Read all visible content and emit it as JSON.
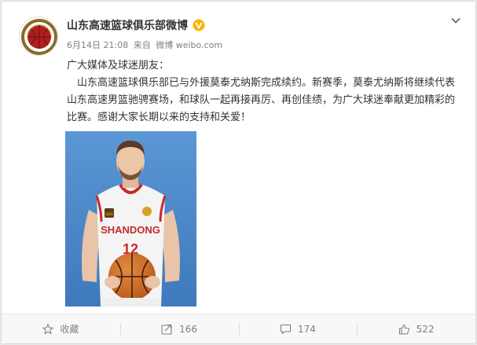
{
  "post": {
    "author": "山东高速篮球俱乐部微博",
    "verified_badge": "V",
    "date": "6月14日 21:08",
    "source_prefix": "来自",
    "source": "微博 weibo.com",
    "greeting": "广大媒体及球迷朋友：",
    "body": "山东高速篮球俱乐部已与外援莫泰尤纳斯完成续约。新赛季，莫泰尤纳斯将继续代表山东高速男篮驰骋赛场，和球队一起再接再厉、再创佳绩，为广大球迷奉献更加精彩的比赛。感谢大家长期以来的支持和关爱！",
    "photo": {
      "jersey_text": "SHANDONG",
      "jersey_number": "12",
      "sponsor": "ups"
    }
  },
  "actions": {
    "favorite": "收藏",
    "repost_count": "166",
    "comment_count": "174",
    "like_count": "522"
  },
  "icons": {
    "verified": "verified-v-icon",
    "menu": "chevron-down-icon",
    "favorite": "star-icon",
    "repost": "repost-icon",
    "comment": "comment-icon",
    "like": "thumbs-up-icon"
  },
  "colors": {
    "accent": "#f7b500",
    "logo_red": "#b01e1e",
    "photo_bg": "#4a86c7"
  }
}
